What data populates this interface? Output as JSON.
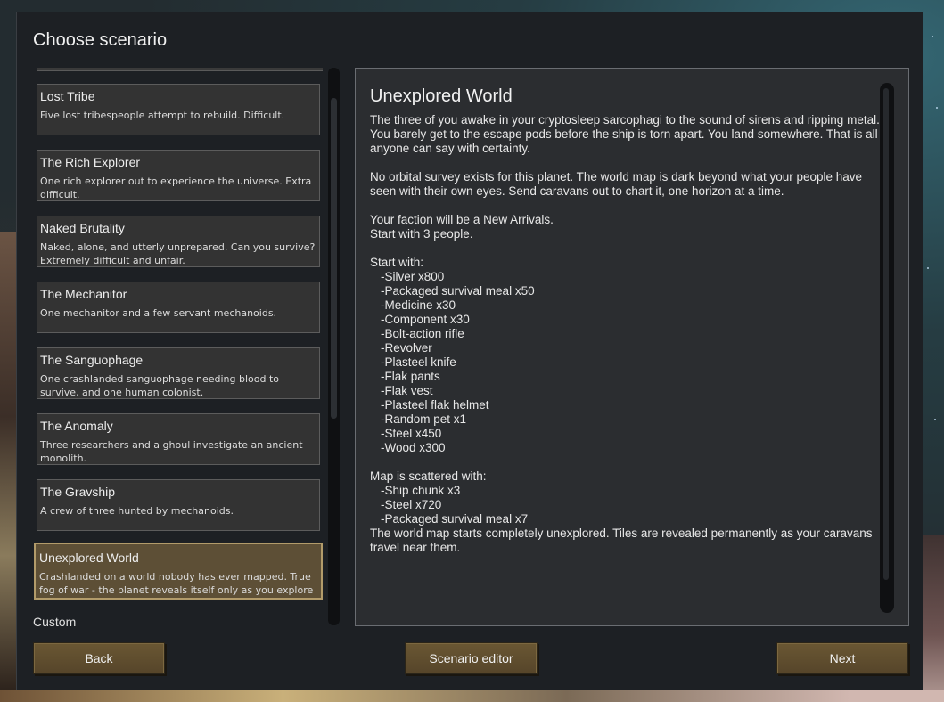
{
  "dialog": {
    "title": "Choose scenario"
  },
  "scenarios": [
    {
      "name": "Lost Tribe",
      "description": "Five lost tribespeople attempt to rebuild. Difficult."
    },
    {
      "name": "The Rich Explorer",
      "description": "One rich explorer out to experience the universe. Extra difficult."
    },
    {
      "name": "Naked Brutality",
      "description": "Naked, alone, and utterly unprepared. Can you survive? Extremely difficult and unfair."
    },
    {
      "name": "The Mechanitor",
      "description": "One mechanitor and a few servant mechanoids."
    },
    {
      "name": "The Sanguophage",
      "description": "One crashlanded sanguophage needing blood to survive, and one human colonist."
    },
    {
      "name": "The Anomaly",
      "description": "Three researchers and a ghoul investigate an ancient monolith."
    },
    {
      "name": "The Gravship",
      "description": "A crew of three hunted by mechanoids."
    },
    {
      "name": "Unexplored World",
      "description": "Crashlanded on a world nobody has ever mapped. True fog of war - the planet reveals itself only as you explore",
      "selected": true
    }
  ],
  "custom_label": "Custom",
  "detail": {
    "title": "Unexplored World",
    "intro": "The three of you awake in your cryptosleep sarcophagi to the sound of sirens and ripping metal. You barely get to the escape pods before the ship is torn apart. You land somewhere. That is all anyone can say with certainty.",
    "survey": "No orbital survey exists for this planet. The world map is dark beyond what your people have seen with their own eyes. Send caravans out to chart it, one horizon at a time.",
    "faction": "Your faction will be a New Arrivals.",
    "people": "Start with 3 people.",
    "start_with_header": "Start with:",
    "start_items": [
      "-Silver x800",
      "-Packaged survival meal x50",
      "-Medicine x30",
      "-Component x30",
      "-Bolt-action rifle",
      "-Revolver",
      "-Plasteel knife",
      "-Flak pants",
      "-Flak vest",
      "-Plasteel flak helmet",
      "-Random pet x1",
      "-Steel x450",
      "-Wood x300"
    ],
    "map_header": "Map is scattered with:",
    "map_items": [
      "-Ship chunk x3",
      "-Steel x720",
      "-Packaged survival meal x7"
    ],
    "closing": "The world map starts completely unexplored. Tiles are revealed permanently as your caravans travel near them."
  },
  "buttons": {
    "back": "Back",
    "editor": "Scenario editor",
    "next": "Next"
  }
}
